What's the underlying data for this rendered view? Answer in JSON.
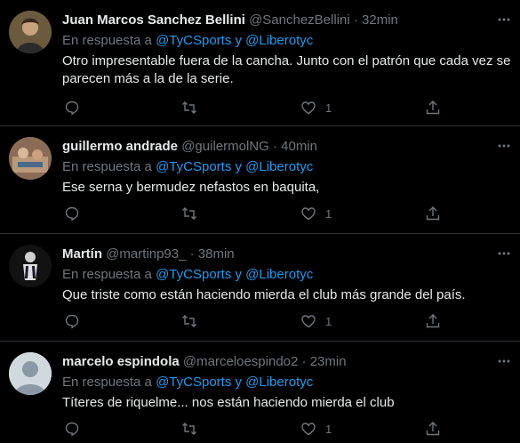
{
  "reply_prefix": "En respuesta a",
  "reply_to": "@TyCSports y @Liberotyc",
  "tweets": [
    {
      "name": "Juan Marcos Sanchez Bellini",
      "handle": "@SanchezBellini",
      "time": "32min",
      "text": "Otro impresentable fuera de la cancha. Junto con el patrón que cada vez se parecen más a la de la serie.",
      "likes": "1"
    },
    {
      "name": "guillermo andrade",
      "handle": "@guilermolNG",
      "time": "40min",
      "text": "Ese serna y bermudez nefastos en baquita,",
      "likes": "1"
    },
    {
      "name": "Martín",
      "handle": "@martinp93_",
      "time": "38min",
      "text": "Que triste como están haciendo mierda el club más grande del país.",
      "likes": "1"
    },
    {
      "name": "marcelo espindola",
      "handle": "@marceloespindo2",
      "time": "23min",
      "text": "Títeres de riquelme... nos están haciendo mierda el club",
      "likes": "1"
    }
  ],
  "colors": {
    "background": "#000000",
    "text": "#e7e9ea",
    "muted": "#71767b",
    "link": "#1d9bf0",
    "divider": "#2f3336"
  }
}
